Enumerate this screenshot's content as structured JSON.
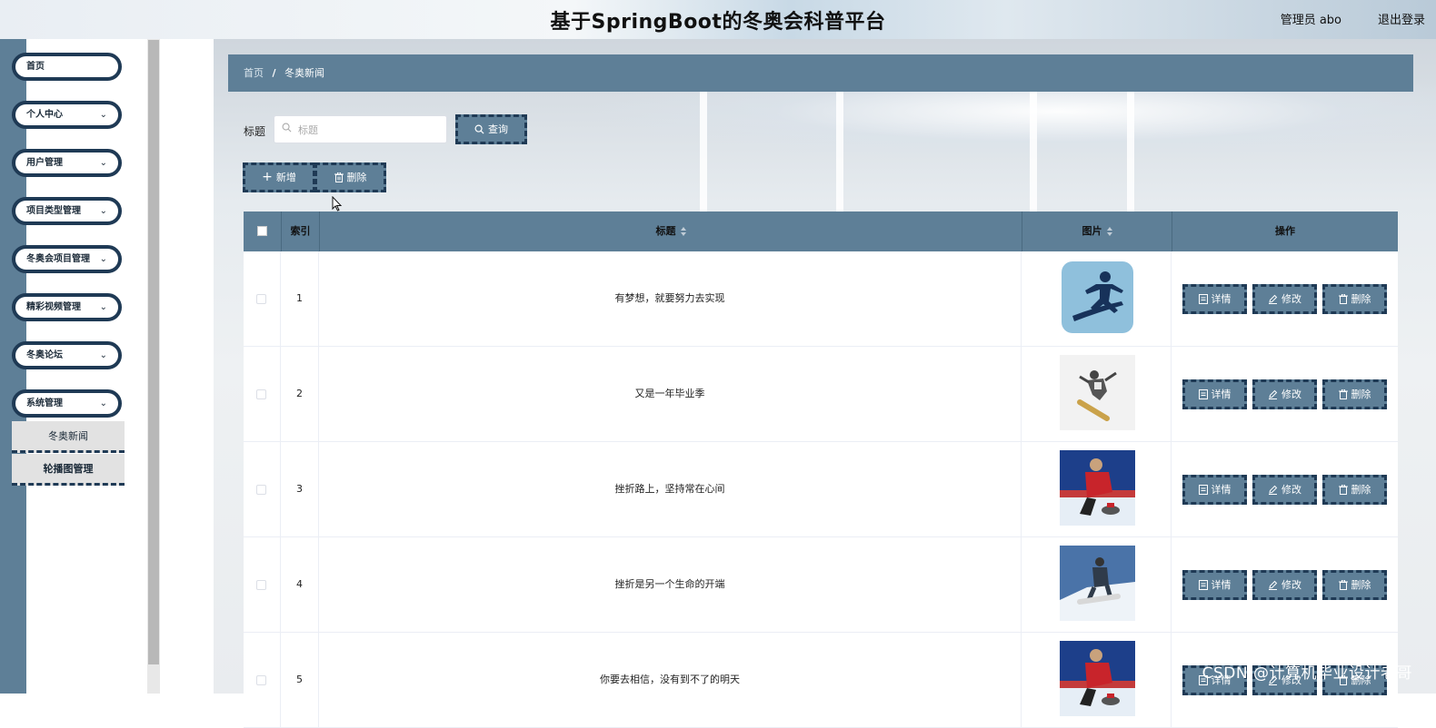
{
  "header": {
    "title": "基于SpringBoot的冬奥会科普平台",
    "user_label": "管理员 abo",
    "logout_label": "退出登录"
  },
  "sidebar": {
    "items": [
      {
        "label": "首页",
        "has_arrow": false
      },
      {
        "label": "个人中心",
        "has_arrow": true
      },
      {
        "label": "用户管理",
        "has_arrow": true
      },
      {
        "label": "项目类型管理",
        "has_arrow": true
      },
      {
        "label": "冬奥会项目管理",
        "has_arrow": true
      },
      {
        "label": "精彩视频管理",
        "has_arrow": true
      },
      {
        "label": "冬奥论坛",
        "has_arrow": true
      },
      {
        "label": "系统管理",
        "has_arrow": true
      }
    ],
    "subitems": [
      {
        "label": "冬奥新闻"
      },
      {
        "label": "轮播图管理"
      }
    ],
    "expand_icon": "chevron-down-icon"
  },
  "breadcrumb": {
    "home": "首页",
    "separator": "/",
    "current": "冬奥新闻"
  },
  "search": {
    "label": "标题",
    "placeholder": "标题",
    "value": "",
    "button_label": "查询"
  },
  "toolbar": {
    "add_label": "新增",
    "delete_label": "删除"
  },
  "table": {
    "columns": {
      "index": "索引",
      "title": "标题",
      "image": "图片",
      "actions": "操作"
    },
    "rows": [
      {
        "index": "1",
        "title": "有梦想，就要努力去实现",
        "image": "snowboard-icon-image"
      },
      {
        "index": "2",
        "title": "又是一年毕业季",
        "image": "snowboarder-jump-photo"
      },
      {
        "index": "3",
        "title": "挫折路上，坚持常在心间",
        "image": "curling-photo"
      },
      {
        "index": "4",
        "title": "挫折是另一个生命的开端",
        "image": "snowboarder-slope-photo"
      },
      {
        "index": "5",
        "title": "你要去相信，没有到不了的明天",
        "image": "curling-photo"
      }
    ],
    "row_actions": {
      "detail": "详情",
      "edit": "修改",
      "delete": "删除"
    }
  },
  "watermark": "CSDN @计算机毕业设计老哥",
  "colors": {
    "primary": "#5e7f97",
    "border_dark": "#1f3a55",
    "sidebar_rail": "#5e7f97"
  }
}
